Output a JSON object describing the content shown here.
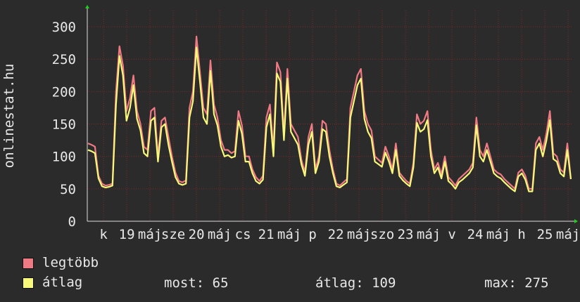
{
  "chart_data": {
    "type": "area",
    "side_label": "onlinestat.hu",
    "x_tick_labels": [
      "k",
      "19",
      "máj",
      "sze",
      "20",
      "máj",
      "cs",
      "21",
      "máj",
      "p",
      "22",
      "máj",
      "szo",
      "23",
      "máj",
      "v",
      "24",
      "máj",
      "h",
      "25",
      "máj"
    ],
    "ylim": [
      0,
      325
    ],
    "y_ticks": [
      0,
      50,
      100,
      150,
      200,
      250,
      300
    ],
    "grid": true,
    "series": [
      {
        "name": "legtöbb",
        "color": "#f07a84",
        "values": [
          120,
          118,
          115,
          70,
          58,
          55,
          56,
          58,
          200,
          270,
          240,
          170,
          190,
          225,
          170,
          150,
          115,
          110,
          170,
          175,
          100,
          155,
          160,
          130,
          100,
          75,
          62,
          60,
          63,
          175,
          200,
          285,
          230,
          175,
          165,
          248,
          180,
          160,
          125,
          110,
          110,
          105,
          108,
          170,
          148,
          100,
          100,
          80,
          68,
          62,
          70,
          160,
          180,
          110,
          245,
          230,
          135,
          235,
          150,
          140,
          130,
          95,
          75,
          130,
          150,
          80,
          100,
          155,
          150,
          110,
          80,
          58,
          55,
          60,
          65,
          175,
          200,
          225,
          235,
          170,
          150,
          140,
          100,
          95,
          90,
          115,
          100,
          80,
          120,
          75,
          68,
          62,
          58,
          90,
          165,
          150,
          155,
          170,
          110,
          80,
          90,
          72,
          100,
          68,
          62,
          55,
          65,
          70,
          75,
          80,
          90,
          160,
          110,
          100,
          120,
          100,
          80,
          75,
          72,
          65,
          60,
          55,
          50,
          75,
          80,
          70,
          50,
          50,
          120,
          130,
          110,
          135,
          170,
          105,
          100,
          80,
          75,
          120,
          65
        ]
      },
      {
        "name": "átlag",
        "color": "#f8f87a",
        "values": [
          110,
          108,
          105,
          66,
          54,
          52,
          53,
          55,
          180,
          255,
          225,
          155,
          175,
          210,
          158,
          140,
          105,
          100,
          155,
          160,
          92,
          145,
          150,
          118,
          92,
          68,
          58,
          56,
          58,
          160,
          185,
          268,
          215,
          160,
          150,
          232,
          165,
          148,
          115,
          100,
          102,
          98,
          100,
          155,
          135,
          92,
          92,
          74,
          62,
          58,
          64,
          145,
          165,
          100,
          228,
          215,
          125,
          220,
          138,
          128,
          118,
          88,
          70,
          118,
          138,
          74,
          92,
          142,
          138,
          100,
          74,
          54,
          52,
          56,
          60,
          160,
          185,
          210,
          220,
          158,
          138,
          128,
          92,
          88,
          84,
          106,
          92,
          74,
          110,
          70,
          63,
          58,
          54,
          83,
          152,
          138,
          142,
          156,
          100,
          74,
          83,
          66,
          92,
          62,
          57,
          50,
          60,
          64,
          69,
          74,
          83,
          148,
          100,
          92,
          110,
          92,
          74,
          69,
          66,
          60,
          55,
          50,
          46,
          69,
          74,
          64,
          46,
          46,
          110,
          120,
          100,
          124,
          156,
          96,
          92,
          74,
          69,
          110,
          65
        ]
      }
    ]
  },
  "legend": {
    "items": [
      {
        "label": "legtöbb",
        "color": "#f07a84"
      },
      {
        "label": "átlag",
        "color": "#f8f87a"
      }
    ]
  },
  "stats": {
    "now": "most: 65",
    "avg": "átlag: 109",
    "max": "max: 275"
  }
}
